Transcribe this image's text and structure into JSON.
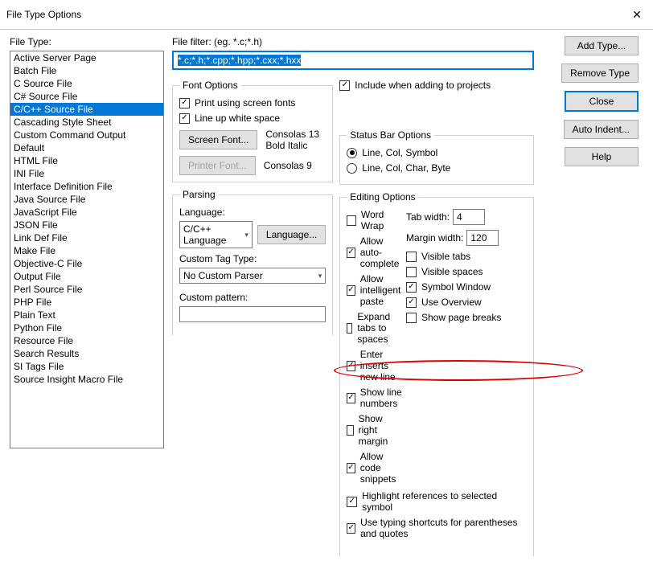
{
  "window": {
    "title": "File Type Options"
  },
  "left": {
    "label": "File Type:",
    "items": [
      "Active Server Page",
      "Batch File",
      "C Source File",
      "C# Source File",
      "C/C++ Source File",
      "Cascading Style Sheet",
      "Custom Command Output",
      "Default",
      "HTML File",
      "INI File",
      "Interface Definition File",
      "Java Source File",
      "JavaScript File",
      "JSON File",
      "Link Def File",
      "Make File",
      "Objective-C File",
      "Output File",
      "Perl Source File",
      "PHP File",
      "Plain Text",
      "Python File",
      "Resource File",
      "Search Results",
      "SI Tags File",
      "Source Insight Macro File"
    ],
    "selected_index": 4
  },
  "filter": {
    "label": "File filter: (eg. *.c;*.h)",
    "value": "*.c;*.h;*.cpp;*.hpp;*.cxx;*.hxx"
  },
  "include": {
    "label": "Include when adding to projects",
    "checked": true
  },
  "font_options": {
    "legend": "Font Options",
    "print_fonts": {
      "label": "Print using screen fonts",
      "checked": true
    },
    "line_up": {
      "label": "Line up white space",
      "checked": true
    },
    "screen_font_btn": "Screen Font...",
    "screen_font_desc1": "Consolas 13",
    "screen_font_desc2": "Bold Italic",
    "printer_font_btn": "Printer Font...",
    "printer_font_desc": "Consolas 9"
  },
  "statusbar": {
    "legend": "Status Bar Options",
    "opt1": "Line, Col, Symbol",
    "opt2": "Line, Col, Char, Byte",
    "selected": 0
  },
  "parsing": {
    "legend": "Parsing",
    "language_label": "Language:",
    "language_value": "C/C++ Language",
    "language_btn": "Language...",
    "tagtype_label": "Custom Tag Type:",
    "tagtype_value": "No Custom Parser",
    "pattern_label": "Custom pattern:",
    "pattern_value": ""
  },
  "editing": {
    "legend": "Editing Options",
    "left": [
      {
        "label": "Word Wrap",
        "checked": false
      },
      {
        "label": "Allow auto-complete",
        "checked": true
      },
      {
        "label": "Allow intelligent paste",
        "checked": true
      },
      {
        "label": "Expand tabs to spaces",
        "checked": false
      },
      {
        "label": "Enter inserts new line",
        "checked": true
      },
      {
        "label": "Show line numbers",
        "checked": true
      },
      {
        "label": "Show right margin",
        "checked": false
      },
      {
        "label": "Allow code snippets",
        "checked": true
      }
    ],
    "tab_width_label": "Tab width:",
    "tab_width_value": "4",
    "margin_width_label": "Margin width:",
    "margin_width_value": "120",
    "right": [
      {
        "label": "Visible tabs",
        "checked": false
      },
      {
        "label": "Visible spaces",
        "checked": false
      },
      {
        "label": "Symbol Window",
        "checked": true
      },
      {
        "label": "Use Overview",
        "checked": true
      },
      {
        "label": "Show page breaks",
        "checked": false
      }
    ],
    "highlight": {
      "label": "Highlight references to selected symbol",
      "checked": true
    },
    "typing": {
      "label": "Use typing shortcuts for parentheses and quotes",
      "checked": true
    }
  },
  "buttons": {
    "add": "Add Type...",
    "remove": "Remove Type",
    "close": "Close",
    "indent": "Auto Indent...",
    "help": "Help"
  },
  "watermark": ""
}
